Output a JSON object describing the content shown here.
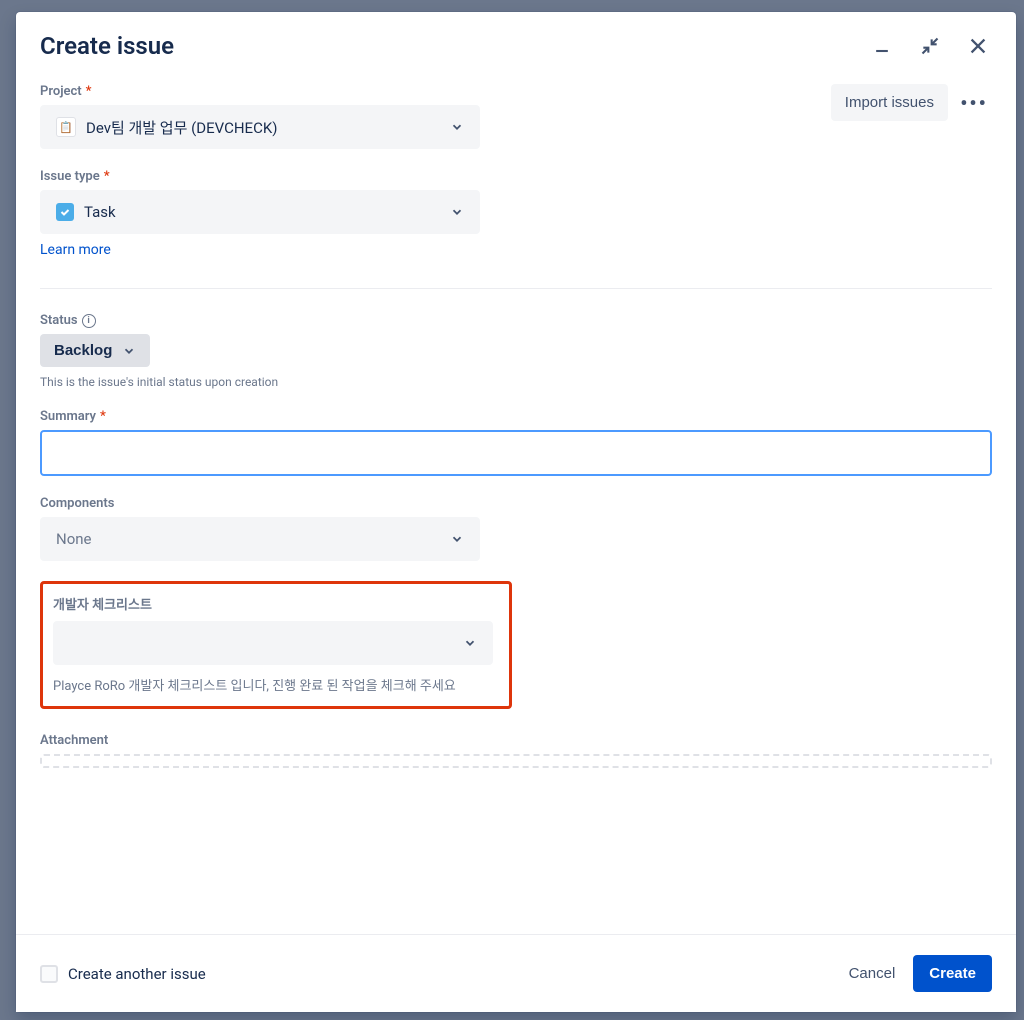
{
  "modal": {
    "title": "Create issue"
  },
  "actions": {
    "import_label": "Import issues"
  },
  "fields": {
    "project": {
      "label": "Project",
      "value": "Dev팀 개발 업무 (DEVCHECK)"
    },
    "issue_type": {
      "label": "Issue type",
      "value": "Task",
      "learn_more": "Learn more"
    },
    "status": {
      "label": "Status",
      "value": "Backlog",
      "helper": "This is the issue's initial status upon creation"
    },
    "summary": {
      "label": "Summary",
      "value": ""
    },
    "components": {
      "label": "Components",
      "value": "None"
    },
    "checklist": {
      "label": "개발자 체크리스트",
      "helper": "Playce RoRo 개발자 체크리스트 입니다, 진행 완료 된 작업을 체크해 주세요"
    },
    "attachment": {
      "label": "Attachment"
    }
  },
  "footer": {
    "create_another": "Create another issue",
    "cancel": "Cancel",
    "create": "Create"
  }
}
